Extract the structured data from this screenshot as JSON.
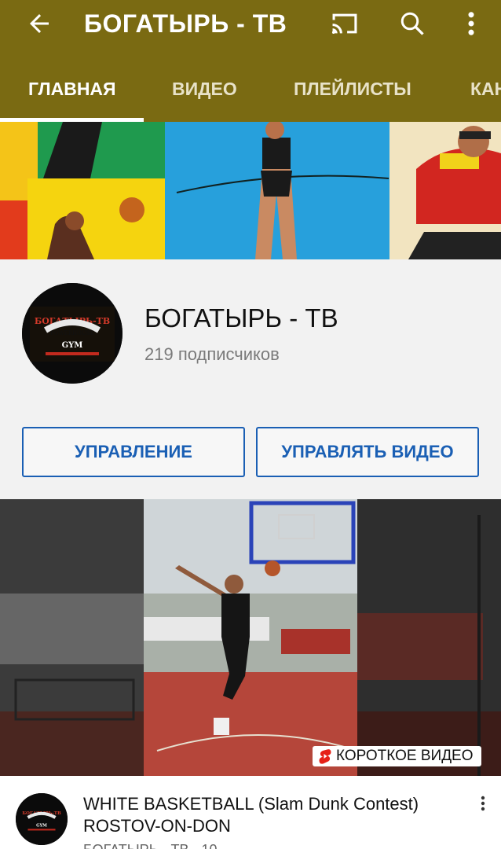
{
  "header": {
    "title": "БОГАТЫРЬ - ТВ",
    "back_icon": "arrow-left-icon",
    "cast_icon": "cast-icon",
    "search_icon": "search-icon",
    "more_icon": "more-vert-icon",
    "background_color": "#7a6a12"
  },
  "tabs": [
    {
      "label": "ГЛАВНАЯ",
      "active": true
    },
    {
      "label": "ВИДЕО",
      "active": false
    },
    {
      "label": "ПЛЕЙЛИСТЫ",
      "active": false
    },
    {
      "label": "КАН",
      "active": false
    }
  ],
  "channel": {
    "name": "БОГАТЫРЬ - ТВ",
    "subscribers": "219 подписчиков",
    "avatar_logo_text": [
      "БОГАТЫРЬ-ТВ",
      "POWERHOUSE",
      "GYM"
    ]
  },
  "buttons": {
    "manage": "УПРАВЛЕНИЕ",
    "manage_video": "УПРАВЛЯТЬ ВИДЕО"
  },
  "featured_video": {
    "badge": "КОРОТКОЕ ВИДЕО",
    "badge_icon": "shorts-icon",
    "title": "WHITE BASKETBALL (Slam Dunk Contest) ROSTOV-ON-DON",
    "meta": "БОГАТЫРЬ - ТВ · 10",
    "more_icon": "more-vert-icon"
  },
  "colors": {
    "accent_blue": "#1a5fb4",
    "appbar": "#7a6a12"
  }
}
